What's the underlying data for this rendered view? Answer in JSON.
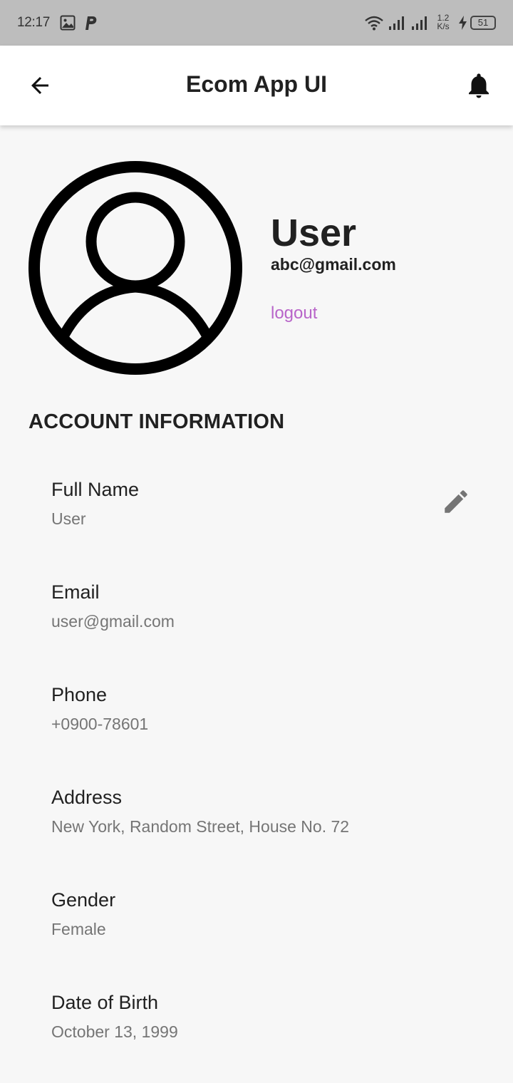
{
  "status_bar": {
    "time": "12:17",
    "speed_top": "1.2",
    "speed_bottom": "K/s",
    "battery": "51",
    "icons": [
      "gallery-icon",
      "p-icon",
      "wifi-icon",
      "signal-icon",
      "signal-icon",
      "charging-icon",
      "battery-icon"
    ]
  },
  "app_bar": {
    "title": "Ecom App UI",
    "back_icon": "arrow-back-icon",
    "notification_icon": "bell-icon"
  },
  "profile": {
    "name": "User",
    "email": "abc@gmail.com",
    "logout_label": "logout",
    "accent_color": "#b865c9"
  },
  "account": {
    "section_title": "ACCOUNT INFORMATION",
    "edit_icon": "pencil-icon",
    "items": [
      {
        "label": "Full Name",
        "value": "User"
      },
      {
        "label": "Email",
        "value": "user@gmail.com"
      },
      {
        "label": "Phone",
        "value": "+0900-78601"
      },
      {
        "label": "Address",
        "value": "New York, Random Street, House No. 72"
      },
      {
        "label": "Gender",
        "value": "Female"
      },
      {
        "label": "Date of Birth",
        "value": "October 13, 1999"
      }
    ]
  }
}
